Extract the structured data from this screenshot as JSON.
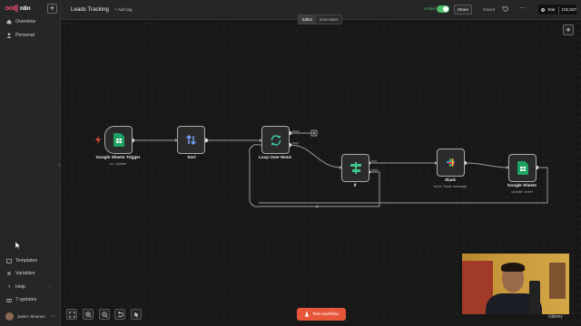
{
  "app": {
    "brand": "n8n",
    "accent": "#ea4b71"
  },
  "sidebar": {
    "items": [
      {
        "label": "Overview",
        "icon": "home-icon"
      },
      {
        "label": "Personal",
        "icon": "user-icon"
      }
    ],
    "bottom_items": [
      {
        "label": "Templates",
        "icon": "box-icon"
      },
      {
        "label": "Variables",
        "icon": "variable-icon"
      },
      {
        "label": "Help",
        "icon": "help-icon"
      },
      {
        "label": "7 updates",
        "icon": "gift-icon"
      }
    ],
    "user_name": "Javier Jimenez"
  },
  "header": {
    "workflow_title": "Leads Tracking",
    "add_tag": "+ Add tag",
    "active_label": "Active",
    "share_label": "Share",
    "saved_label": "Saved",
    "github_star": "Star",
    "github_count": "102,637"
  },
  "canvas": {
    "tabs": [
      {
        "label": "Editor",
        "active": true
      },
      {
        "label": "Executions",
        "active": false
      }
    ],
    "nodes": [
      {
        "id": "sheets-trigger",
        "label": "Google Sheets Trigger",
        "sub": "on: Update"
      },
      {
        "id": "sort",
        "label": "Sort",
        "sub": ""
      },
      {
        "id": "loop",
        "label": "Loop Over Items",
        "sub": ""
      },
      {
        "id": "if",
        "label": "If",
        "sub": ""
      },
      {
        "id": "slack",
        "label": "Slack",
        "sub": "send: Slack message"
      },
      {
        "id": "sheets",
        "label": "Google Sheets",
        "sub": "update: sheet"
      }
    ],
    "port_labels": {
      "done": "done",
      "loop": "loop",
      "true": "true",
      "false": "false"
    }
  },
  "controls": {
    "test_button": "Test workflow"
  },
  "watermark": "Udemy"
}
